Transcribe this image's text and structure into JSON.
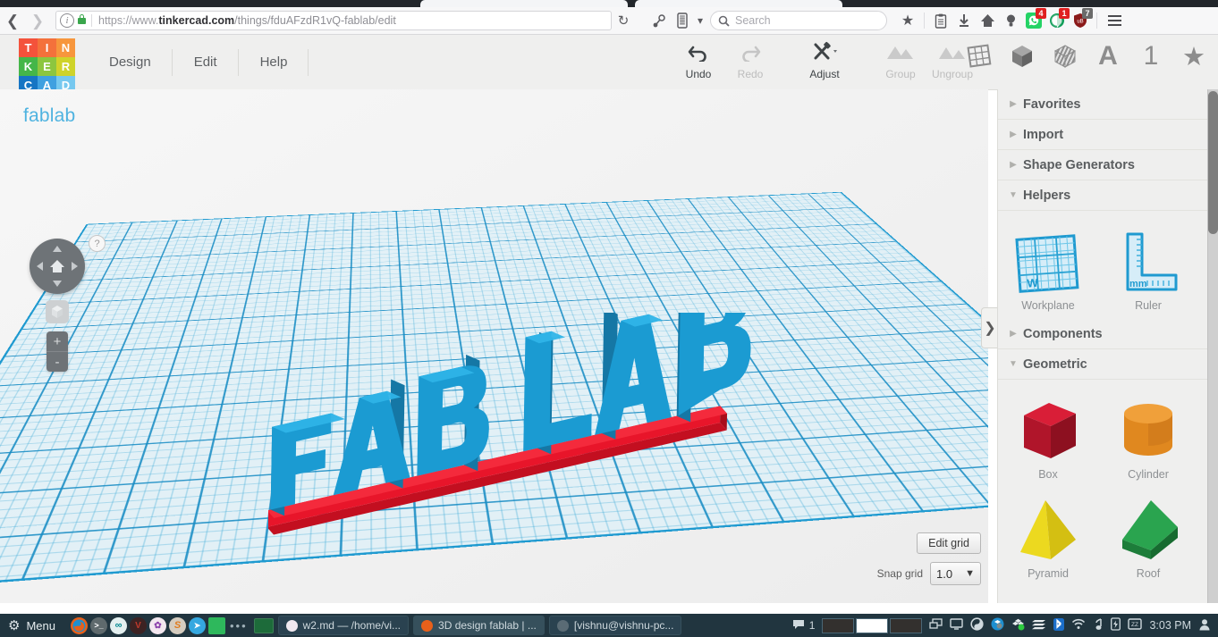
{
  "browser": {
    "back_icon": "back-arrow-icon",
    "forward_icon": "forward-arrow-icon",
    "url_prefix": "https://www.",
    "url_domain": "tinkercad.com",
    "url_path": "/things/fduAFzdR1vQ-fablab/edit",
    "reload_icon": "reload-icon",
    "search_placeholder": "Search",
    "icons": [
      "pocket-icon",
      "reader-icon",
      "chevron-down-icon",
      "bookmark-star-icon",
      "library-icon",
      "downloads-icon",
      "home-icon",
      "lightbulb-icon",
      "whatsapp-icon",
      "hangouts-icon",
      "ublock-icon",
      "menu-icon"
    ],
    "badges": [
      {
        "name": "whatsapp-badge",
        "count": "4",
        "color": "#e02020"
      },
      {
        "name": "hangouts-badge",
        "count": "1",
        "color": "#e02020"
      },
      {
        "name": "ublock-badge",
        "count": "7",
        "color": "#6b6b6b"
      }
    ]
  },
  "logo": {
    "tiles": [
      {
        "letter": "T",
        "color": "#f4523b"
      },
      {
        "letter": "I",
        "color": "#f4713b"
      },
      {
        "letter": "N",
        "color": "#f7963c"
      },
      {
        "letter": "K",
        "color": "#45b649"
      },
      {
        "letter": "E",
        "color": "#8cc63f"
      },
      {
        "letter": "R",
        "color": "#cfd32a"
      },
      {
        "letter": "C",
        "color": "#1675c4"
      },
      {
        "letter": "A",
        "color": "#3fa0e0"
      },
      {
        "letter": "D",
        "color": "#76c8ef"
      }
    ]
  },
  "menu": {
    "items": [
      "Design",
      "Edit",
      "Help"
    ]
  },
  "toolbar": {
    "tools": [
      {
        "label": "Undo",
        "icon": "undo-icon",
        "enabled": true
      },
      {
        "label": "Redo",
        "icon": "redo-icon",
        "enabled": false
      },
      {
        "label": "Adjust",
        "icon": "adjust-icon",
        "enabled": true
      },
      {
        "label": "Group",
        "icon": "group-icon",
        "enabled": false
      },
      {
        "label": "Ungroup",
        "icon": "ungroup-icon",
        "enabled": false
      }
    ],
    "right_icons": [
      {
        "name": "workplane-icon",
        "glyph": "grid"
      },
      {
        "name": "solid-box-icon",
        "glyph": "cube"
      },
      {
        "name": "hole-box-icon",
        "glyph": "striped-cube"
      },
      {
        "name": "text-icon",
        "glyph": "A"
      },
      {
        "name": "numbers-icon",
        "glyph": "1"
      },
      {
        "name": "favorites-star-icon",
        "glyph": "star"
      }
    ]
  },
  "canvas": {
    "design_name": "fablab",
    "help_label": "?",
    "nav": {
      "home_icon": "home-view-icon",
      "up_icon": "view-up-icon",
      "down_icon": "view-down-icon",
      "left_icon": "view-left-icon",
      "right_icon": "view-right-icon",
      "fit_icon": "fit-to-view-icon",
      "zoom_in": "+",
      "zoom_out": "-"
    },
    "edit_grid_label": "Edit grid",
    "snap_grid_label": "Snap grid",
    "snap_grid_value": "1.0",
    "model_text": "FAB LAB",
    "model_color": "#1b9bd2",
    "base_color": "#e8152a",
    "grid_color": "#1f9ad0",
    "panel_handle_icon": "collapse-panel-icon"
  },
  "panel": {
    "sections": [
      {
        "title": "Favorites",
        "expanded": false
      },
      {
        "title": "Import",
        "expanded": false
      },
      {
        "title": "Shape Generators",
        "expanded": false
      },
      {
        "title": "Helpers",
        "expanded": true
      },
      {
        "title": "Components",
        "expanded": false
      },
      {
        "title": "Geometric",
        "expanded": true
      }
    ],
    "helpers": [
      {
        "label": "Workplane",
        "icon": "workplane-shape-icon",
        "badge": "W"
      },
      {
        "label": "Ruler",
        "icon": "ruler-shape-icon",
        "badge": "mm"
      }
    ],
    "geometric": [
      {
        "label": "Box",
        "icon": "box-shape-icon",
        "color": "#c8102e"
      },
      {
        "label": "Cylinder",
        "icon": "cylinder-shape-icon",
        "color": "#e2861f"
      },
      {
        "label": "Pyramid",
        "icon": "pyramid-shape-icon",
        "color": "#e8c818"
      },
      {
        "label": "Roof",
        "icon": "roof-shape-icon",
        "color": "#2aa44f"
      }
    ]
  },
  "taskbar": {
    "menu_label": "Menu",
    "menu_icon": "gear-icon",
    "launchers": [
      {
        "name": "firefox-icon",
        "color": "#e8601a",
        "glyph": "🌐"
      },
      {
        "name": "terminal-icon",
        "color": "#6b6b6b",
        "glyph": ">_"
      },
      {
        "name": "arduino-icon",
        "color": "#e9f2f2",
        "glyph": "∞"
      },
      {
        "name": "vim-icon",
        "color": "#3b2424",
        "glyph": "V"
      },
      {
        "name": "krita-icon",
        "color": "#f2e6ee",
        "glyph": "✿"
      },
      {
        "name": "sublime-icon",
        "color": "#d8cfc2",
        "glyph": "S"
      },
      {
        "name": "telegram-icon",
        "color": "#35a8e0",
        "glyph": "➤"
      },
      {
        "name": "files-icon",
        "color": "#2eb85c",
        "glyph": ""
      }
    ],
    "more_icon": "more-apps-icon",
    "desktop_icon": "show-desktop-icon",
    "windows": [
      {
        "title": "w2.md — /home/vi...",
        "icon_color": "#e8eef0",
        "name": "window-button-w2md"
      },
      {
        "title": "3D design fablab | ...",
        "icon_color": "#e8601a",
        "name": "window-button-tinkercad",
        "active": true
      },
      {
        "title": "[vishnu@vishnu-pc...",
        "icon_color": "#5a6b75",
        "name": "window-button-terminal"
      }
    ],
    "notification_count": "1",
    "notification_icon": "chat-icon",
    "workspaces": 3,
    "active_workspace": 2,
    "tray_icons": [
      "displays-icon",
      "monitor-icon",
      "shutter-icon",
      "dropbox-icon",
      "dropbox-sync-icon",
      "network-icon",
      "bluetooth-icon",
      "wifi-icon",
      "audio-icon",
      "battery-icon",
      "sleep-icon"
    ],
    "clock": "3:03 PM",
    "user_icon": "user-icon"
  }
}
